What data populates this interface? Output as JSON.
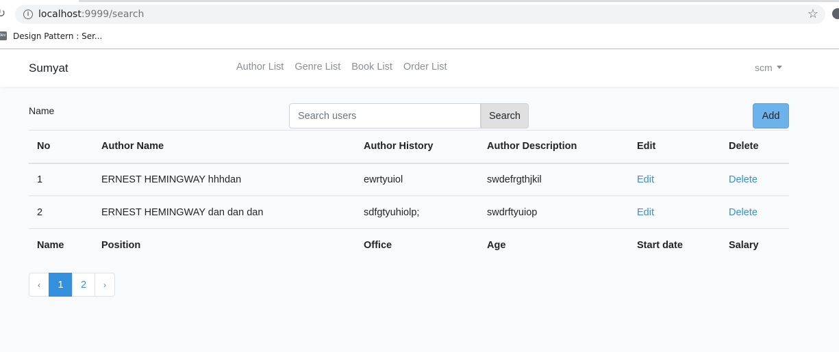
{
  "browser": {
    "url_host": "localhost",
    "url_rest": ":9999/search",
    "bookmark": "Design Pattern : Ser...",
    "favicon_text": "dev"
  },
  "navbar": {
    "brand": "Sumyat",
    "links": [
      "Author List",
      "Genre List",
      "Book List",
      "Order List"
    ],
    "user": "scm"
  },
  "search": {
    "label": "Name",
    "placeholder": "Search users",
    "button": "Search",
    "add_button": "Add"
  },
  "table": {
    "headers": [
      "No",
      "Author Name",
      "Author History",
      "Author Description",
      "Edit",
      "Delete"
    ],
    "rows": [
      {
        "no": "1",
        "name": "ERNEST HEMINGWAY hhhdan",
        "history": "ewrtyuiol",
        "description": "swdefrgthjkil",
        "edit": "Edit",
        "delete": "Delete"
      },
      {
        "no": "2",
        "name": "ERNEST HEMINGWAY dan dan dan",
        "history": "sdfgtyuhiolp;",
        "description": "swdrftyuiop",
        "edit": "Edit",
        "delete": "Delete"
      }
    ],
    "footer": [
      "Name",
      "Position",
      "Office",
      "Age",
      "Start date",
      "Salary"
    ]
  },
  "pagination": {
    "prev": "‹",
    "pages": [
      "1",
      "2"
    ],
    "next": "›",
    "active": "1"
  },
  "colors": {
    "primary": "#3490dc",
    "add_button": "#6cb2eb",
    "background": "#f8fafc"
  }
}
